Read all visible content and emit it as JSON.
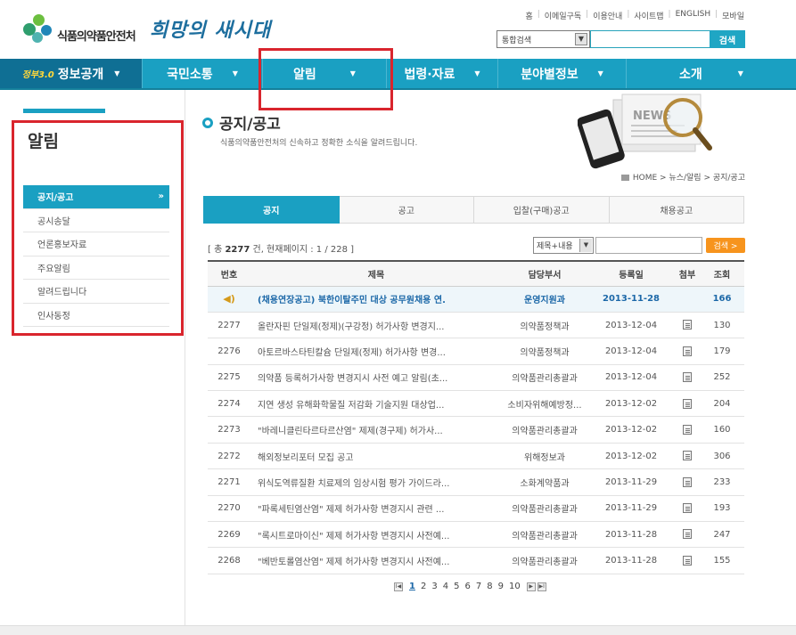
{
  "header": {
    "logo_text": "식품의약품안전처",
    "slogan": "희망의 새시대",
    "util_nav": [
      "홈",
      "이메일구독",
      "이용안내",
      "사이트맵",
      "ENGLISH",
      "모바일"
    ],
    "search": {
      "scope": "통합검색",
      "button": "검색"
    }
  },
  "gnb": [
    {
      "badge": "정부3.0",
      "label": "정보공개"
    },
    {
      "label": "국민소통"
    },
    {
      "label": "알림"
    },
    {
      "label": "법령·자료"
    },
    {
      "label": "분야별정보"
    },
    {
      "label": "소개"
    }
  ],
  "lnb": {
    "title": "알림",
    "items": [
      "공지/공고",
      "공시송달",
      "언론홍보자료",
      "주요알림",
      "알려드립니다",
      "인사동정"
    ],
    "active_marker": "»"
  },
  "content": {
    "title": "공지/공고",
    "subtitle": "식품의약품안전처의 신속하고 정확한 소식을 알려드립니다.",
    "breadcrumb": "HOME > 뉴스/알림 > 공지/공고",
    "tabs": [
      "공지",
      "공고",
      "입찰(구매)공고",
      "채용공고"
    ],
    "count_prefix": "[ 총 ",
    "count_total": "2277",
    "count_suffix": " 건, 현재페이지 : 1 / 228 ]",
    "filter": {
      "select": "제목+내용",
      "button": "검색 >"
    },
    "table": {
      "headers": [
        "번호",
        "제목",
        "담당부서",
        "등록일",
        "첨부",
        "조회"
      ],
      "notice": {
        "title": "(채용연장공고) 북한이탈주민 대상 공무원채용 연.",
        "dept": "운영지원과",
        "date": "2013-11-28",
        "views": "166"
      },
      "rows": [
        {
          "no": "2277",
          "title": "올란자핀 단일제(정제)(구강정) 허가사항 변경지...",
          "dept": "의약품정책과",
          "date": "2013-12-04",
          "views": "130"
        },
        {
          "no": "2276",
          "title": "아토르바스타틴칼슘 단일제(정제) 허가사항 변경...",
          "dept": "의약품정책과",
          "date": "2013-12-04",
          "views": "179"
        },
        {
          "no": "2275",
          "title": "의약품 등록허가사항 변경지시 사전 예고 알림(초...",
          "dept": "의약품관리총괄과",
          "date": "2013-12-04",
          "views": "252"
        },
        {
          "no": "2274",
          "title": "지연 생성 유해화학물질 저감화 기술지원 대상업...",
          "dept": "소비자위해예방정...",
          "date": "2013-12-02",
          "views": "204"
        },
        {
          "no": "2273",
          "title": "\"바레니클린타르타르산염\" 제제(경구제) 허가사...",
          "dept": "의약품관리총괄과",
          "date": "2013-12-02",
          "views": "160"
        },
        {
          "no": "2272",
          "title": "해외정보리포터 모집 공고",
          "dept": "위해정보과",
          "date": "2013-12-02",
          "views": "306"
        },
        {
          "no": "2271",
          "title": "위식도역류질환 치료제의 임상시험 평가 가이드라...",
          "dept": "소화계약품과",
          "date": "2013-11-29",
          "views": "233"
        },
        {
          "no": "2270",
          "title": "\"파록세틴염산염\" 제제 허가사항 변경지시 관련 ...",
          "dept": "의약품관리총괄과",
          "date": "2013-11-29",
          "views": "193"
        },
        {
          "no": "2269",
          "title": "\"록시트로마이신\" 제제 허가사항 변경지시 사전예...",
          "dept": "의약품관리총괄과",
          "date": "2013-11-28",
          "views": "247"
        },
        {
          "no": "2268",
          "title": "\"베반토롤염산염\" 제제 허가사항 변경지시 사전예...",
          "dept": "의약품관리총괄과",
          "date": "2013-11-28",
          "views": "155"
        }
      ]
    },
    "pager": [
      "1",
      "2",
      "3",
      "4",
      "5",
      "6",
      "7",
      "8",
      "9",
      "10"
    ],
    "pager_current": "1",
    "news_label": "NEWS"
  },
  "colors": {
    "accent": "#1aa0c2",
    "annotation": "#d9252d",
    "notice_text": "#1c68a8"
  }
}
